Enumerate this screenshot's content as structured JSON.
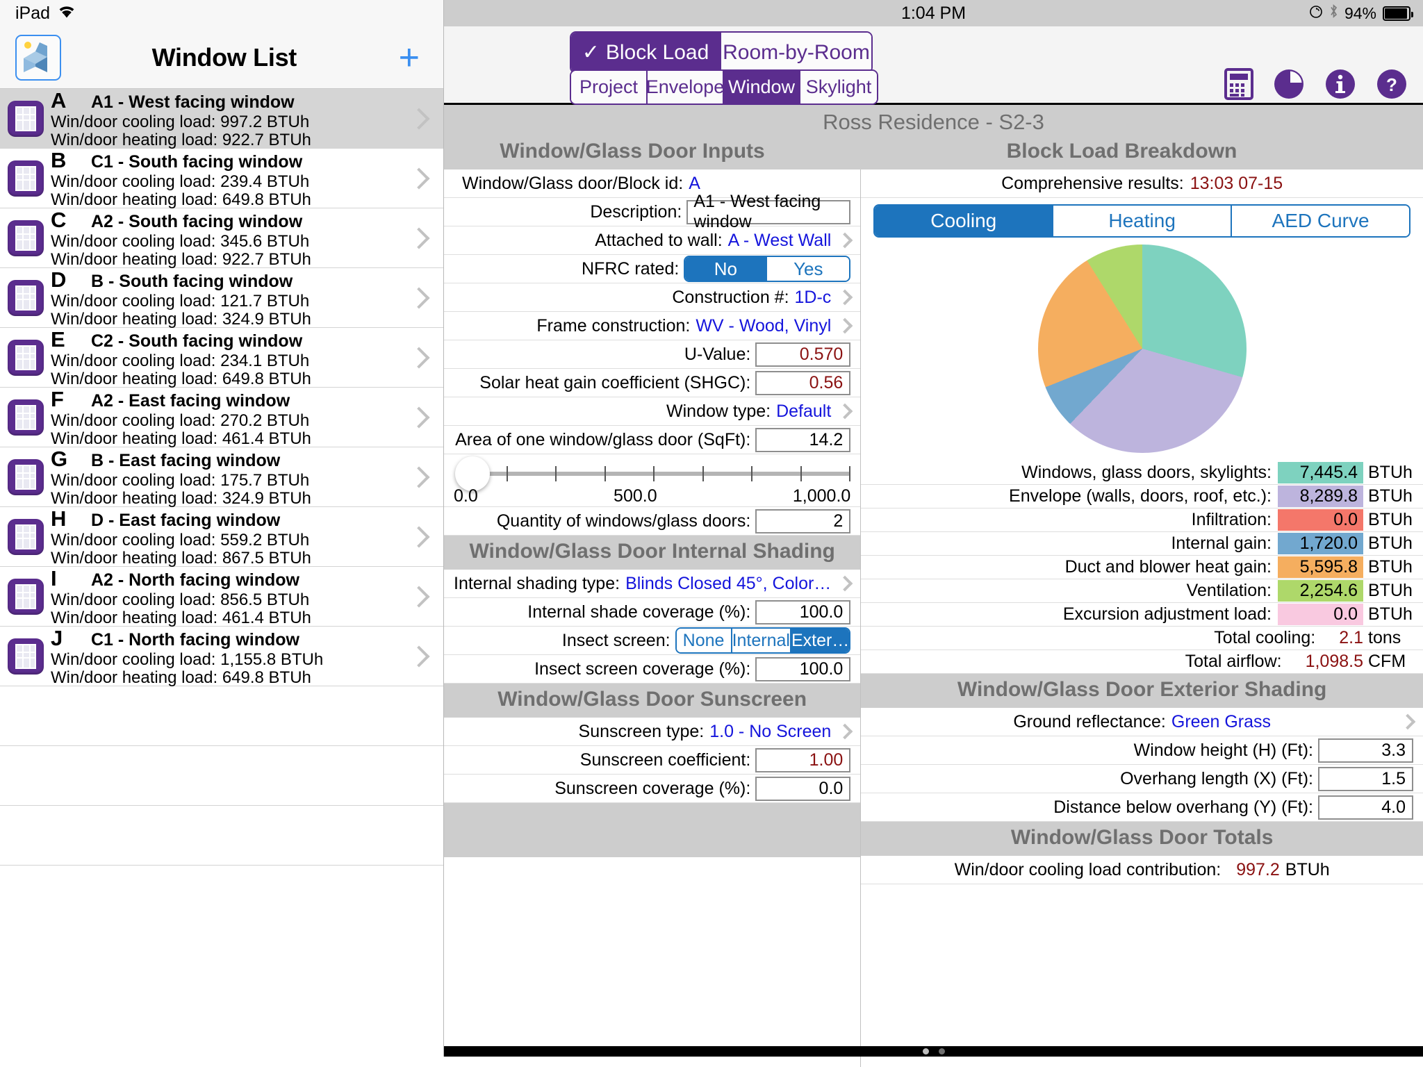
{
  "device": {
    "name": "iPad",
    "time": "1:04 PM",
    "battery_pct": "94%",
    "wifi_icon": "wifi-icon",
    "lock_rotation_icon": "rotation-lock-icon",
    "bluetooth_icon": "bluetooth-icon"
  },
  "sidebar": {
    "title": "Window List",
    "add_button": "+",
    "items": [
      {
        "letter": "A",
        "name": "A1 - West facing window",
        "cooling": "Win/door cooling load: 997.2 BTUh",
        "heating": "Win/door heating load: 922.7 BTUh",
        "selected": true
      },
      {
        "letter": "B",
        "name": "C1 - South facing window",
        "cooling": "Win/door cooling load: 239.4 BTUh",
        "heating": "Win/door heating load: 649.8 BTUh",
        "selected": false
      },
      {
        "letter": "C",
        "name": "A2 - South facing window",
        "cooling": "Win/door cooling load: 345.6 BTUh",
        "heating": "Win/door heating load: 922.7 BTUh",
        "selected": false
      },
      {
        "letter": "D",
        "name": "B - South facing window",
        "cooling": "Win/door cooling load: 121.7 BTUh",
        "heating": "Win/door heating load: 324.9 BTUh",
        "selected": false
      },
      {
        "letter": "E",
        "name": "C2 - South facing window",
        "cooling": "Win/door cooling load: 234.1 BTUh",
        "heating": "Win/door heating load: 649.8 BTUh",
        "selected": false
      },
      {
        "letter": "F",
        "name": "A2 - East facing window",
        "cooling": "Win/door cooling load: 270.2 BTUh",
        "heating": "Win/door heating load: 461.4 BTUh",
        "selected": false
      },
      {
        "letter": "G",
        "name": "B - East facing window",
        "cooling": "Win/door cooling load: 175.7 BTUh",
        "heating": "Win/door heating load: 324.9 BTUh",
        "selected": false
      },
      {
        "letter": "H",
        "name": "D - East facing window",
        "cooling": "Win/door cooling load: 559.2 BTUh",
        "heating": "Win/door heating load: 867.5 BTUh",
        "selected": false
      },
      {
        "letter": "I",
        "name": "A2 - North facing window",
        "cooling": "Win/door cooling load: 856.5 BTUh",
        "heating": "Win/door heating load: 461.4 BTUh",
        "selected": false
      },
      {
        "letter": "J",
        "name": "C1 - North facing window",
        "cooling": "Win/door cooling load: 1,155.8 BTUh",
        "heating": "Win/door heating load: 649.8 BTUh",
        "selected": false
      }
    ]
  },
  "toolbar": {
    "mode_tabs": [
      {
        "label": "Block Load",
        "active": true,
        "check": "✓"
      },
      {
        "label": "Room-by-Room",
        "active": false
      }
    ],
    "category_tabs": [
      {
        "label": "Project",
        "active": false
      },
      {
        "label": "Envelope",
        "active": false
      },
      {
        "label": "Window",
        "active": true
      },
      {
        "label": "Skylight",
        "active": false
      }
    ],
    "icons": [
      {
        "name": "calculator-icon"
      },
      {
        "name": "pie-chart-icon"
      },
      {
        "name": "info-icon"
      },
      {
        "name": "help-icon"
      }
    ]
  },
  "project_title": "Ross Residence - S2-3",
  "panes": {
    "left_heading": "Window/Glass Door Inputs",
    "right_heading": "Block Load Breakdown"
  },
  "inputs": {
    "block_id_label": "Window/Glass door/Block id:",
    "block_id_value": "A",
    "description_label": "Description:",
    "description_value": "A1 - West facing window",
    "attached_wall_label": "Attached to wall:",
    "attached_wall_value": "A - West Wall",
    "nfrc_label": "NFRC rated:",
    "nfrc_options": [
      {
        "label": "No",
        "active": true
      },
      {
        "label": "Yes",
        "active": false
      }
    ],
    "construction_label": "Construction #:",
    "construction_value": "1D-c",
    "frame_label": "Frame construction:",
    "frame_value": "WV - Wood, Vinyl",
    "uvalue_label": "U-Value:",
    "uvalue_value": "0.570",
    "shgc_label": "Solar heat gain coefficient (SHGC):",
    "shgc_value": "0.56",
    "window_type_label": "Window type:",
    "window_type_value": "Default",
    "area_label": "Area of one window/glass door (SqFt):",
    "area_value": "14.2",
    "slider": {
      "min_label": "0.0",
      "mid_label": "500.0",
      "max_label": "1,000.0",
      "value": 14.2,
      "min": 0,
      "max": 1000
    },
    "quantity_label": "Quantity of windows/glass doors:",
    "quantity_value": "2"
  },
  "internal_shading": {
    "heading": "Window/Glass Door Internal Shading",
    "type_label": "Internal shading type:",
    "type_value": "Blinds Closed 45°, Color…",
    "coverage_label": "Internal shade coverage (%):",
    "coverage_value": "100.0",
    "insect_label": "Insect screen:",
    "insect_options": [
      {
        "label": "None",
        "active": false
      },
      {
        "label": "Internal",
        "active": false
      },
      {
        "label": "Exter…",
        "active": true
      }
    ],
    "insect_coverage_label": "Insect screen coverage (%):",
    "insect_coverage_value": "100.0"
  },
  "sunscreen": {
    "heading": "Window/Glass Door Sunscreen",
    "type_label": "Sunscreen type:",
    "type_value": "1.0 - No Screen",
    "coeff_label": "Sunscreen coefficient:",
    "coeff_value": "1.00",
    "coverage_label": "Sunscreen coverage (%):",
    "coverage_value": "0.0"
  },
  "breakdown": {
    "results_label": "Comprehensive results:",
    "results_time": "13:03 07-15",
    "tabs": [
      {
        "label": "Cooling",
        "active": true
      },
      {
        "label": "Heating",
        "active": false
      },
      {
        "label": "AED Curve",
        "active": false
      }
    ],
    "totals": [
      {
        "label": "Total cooling:",
        "value": "2.1",
        "unit": "tons"
      },
      {
        "label": "Total airflow:",
        "value": "1,098.5",
        "unit": "CFM"
      }
    ]
  },
  "chart_data": {
    "type": "pie",
    "title": "Block Load Breakdown",
    "unit": "BTUh",
    "legend_position": "below",
    "categories": [
      "Windows, glass doors, skylights:",
      "Envelope (walls, doors, roof, etc.):",
      "Infiltration:",
      "Internal gain:",
      "Duct and blower heat gain:",
      "Ventilation:",
      "Excursion adjustment load:"
    ],
    "values": [
      7445.4,
      8289.8,
      0.0,
      1720.0,
      5595.8,
      2254.6,
      0.0
    ],
    "value_labels": [
      "7,445.4",
      "8,289.8",
      "0.0",
      "1,720.0",
      "5,595.8",
      "2,254.6",
      "0.0"
    ],
    "colors": [
      "#7ed2bf",
      "#bdb4dd",
      "#f4776a",
      "#72a8cf",
      "#f5ae5f",
      "#aed86a",
      "#f9c9e0"
    ]
  },
  "exterior_shading": {
    "heading": "Window/Glass Door Exterior Shading",
    "ground_label": "Ground reflectance:",
    "ground_value": "Green Grass",
    "height_label": "Window height (H) (Ft):",
    "height_value": "3.3",
    "overhang_label": "Overhang length (X) (Ft):",
    "overhang_value": "1.5",
    "distance_label": "Distance below overhang (Y) (Ft):",
    "distance_value": "4.0"
  },
  "totals_section": {
    "heading": "Window/Glass Door Totals",
    "cooling_label": "Win/door cooling load contribution:",
    "cooling_value": "997.2",
    "cooling_unit": "BTUh"
  }
}
